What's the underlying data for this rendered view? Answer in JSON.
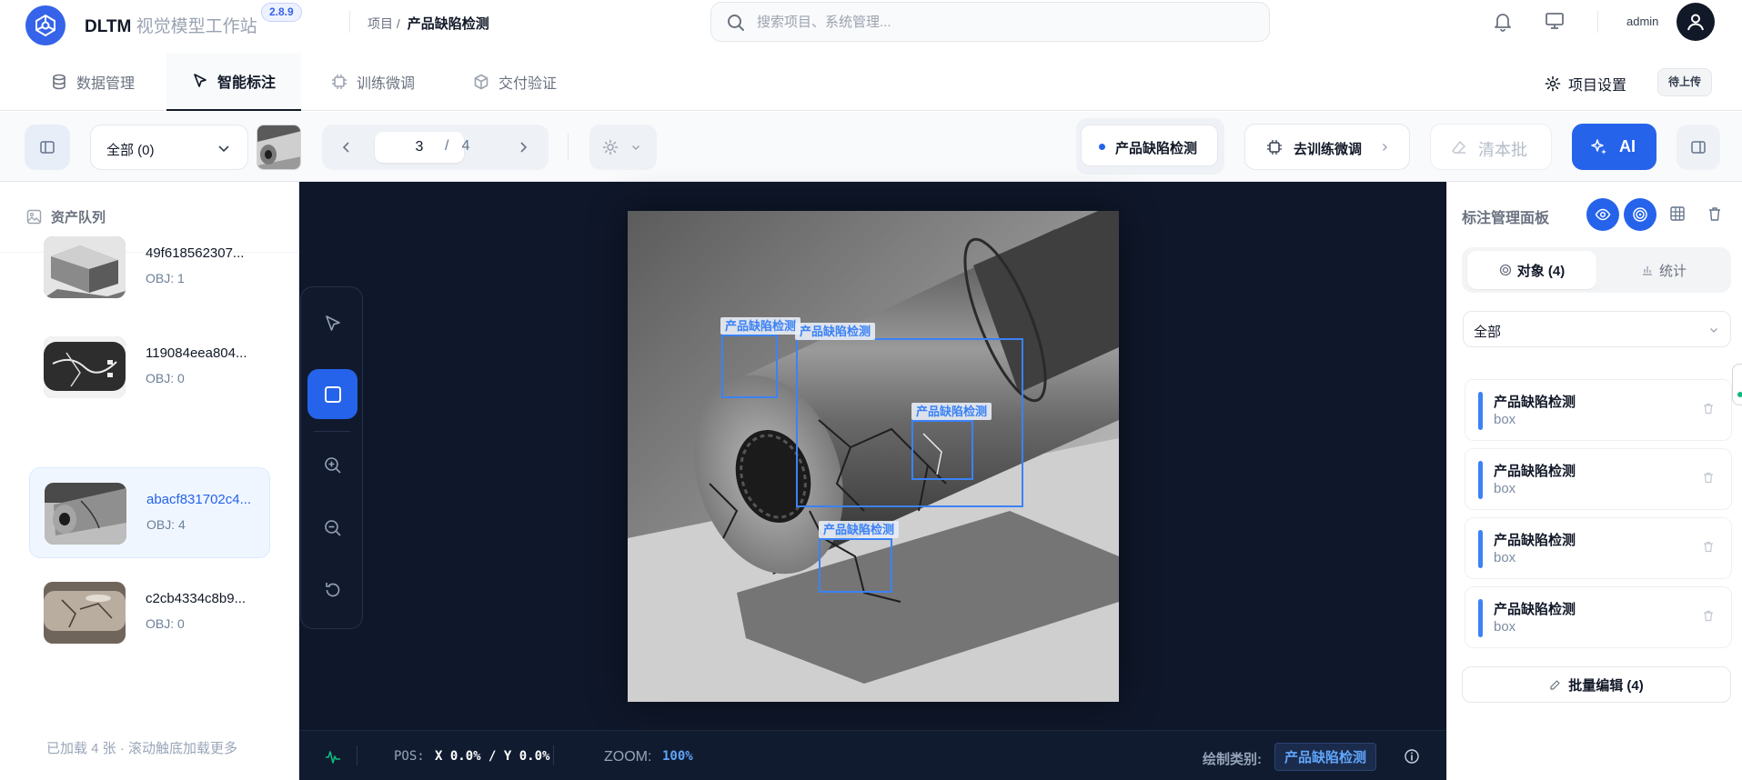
{
  "app": {
    "name": "DLTM",
    "subtitle": "视觉模型工作站",
    "version": "2.8.9"
  },
  "breadcrumb": {
    "parent": "项目 /",
    "current": "产品缺陷检测"
  },
  "search": {
    "placeholder": "搜索项目、系统管理..."
  },
  "user": {
    "name": "admin"
  },
  "tabs": [
    {
      "label": "数据管理",
      "icon": "database-icon"
    },
    {
      "label": "智能标注",
      "icon": "cursor-icon"
    },
    {
      "label": "训练微调",
      "icon": "chip-icon"
    },
    {
      "label": "交付验证",
      "icon": "cube-icon"
    }
  ],
  "project_settings": "项目设置",
  "upload_status": "待上传",
  "toolbar": {
    "filter_label": "全部 (0)",
    "page_current": "3",
    "page_sep": "/",
    "page_total": "4",
    "class_chip": "产品缺陷检测",
    "train_button": "去训练微调",
    "clear_button": "清本批",
    "ai_button": "AI"
  },
  "sidebar": {
    "title": "资产队列",
    "assets": [
      {
        "name": "49f618562307...",
        "obj": "OBJ: 1"
      },
      {
        "name": "119084eea804...",
        "obj": "OBJ: 0"
      },
      {
        "name": "abacf831702c4...",
        "obj": "OBJ: 4"
      },
      {
        "name": "c2cb4334c8b9...",
        "obj": "OBJ: 0"
      }
    ],
    "footer": "已加载 4 张 · 滚动触底加载更多"
  },
  "annotations": [
    {
      "label": "产品缺陷检测"
    },
    {
      "label": "产品缺陷检测"
    },
    {
      "label": "产品缺陷检测"
    },
    {
      "label": "产品缺陷检测"
    }
  ],
  "status": {
    "pos_label": "POS:",
    "pos_value": "X 0.0% / Y 0.0%",
    "zoom_label": "ZOOM:",
    "zoom_value": "100%",
    "draw_class_label": "绘制类别:",
    "draw_class_value": "产品缺陷检测"
  },
  "panel": {
    "title": "标注管理面板",
    "tab_objects": "对象 (4)",
    "tab_stats": "统计",
    "filter": "全部",
    "objects": [
      {
        "name": "产品缺陷检测",
        "type": "box"
      },
      {
        "name": "产品缺陷检测",
        "type": "box"
      },
      {
        "name": "产品缺陷检测",
        "type": "box"
      },
      {
        "name": "产品缺陷检测",
        "type": "box"
      }
    ],
    "batch_edit": "批量编辑 (4)"
  },
  "colors": {
    "accent": "#2563eb",
    "canvas": "#0f172a",
    "box": "#3b82f6"
  }
}
